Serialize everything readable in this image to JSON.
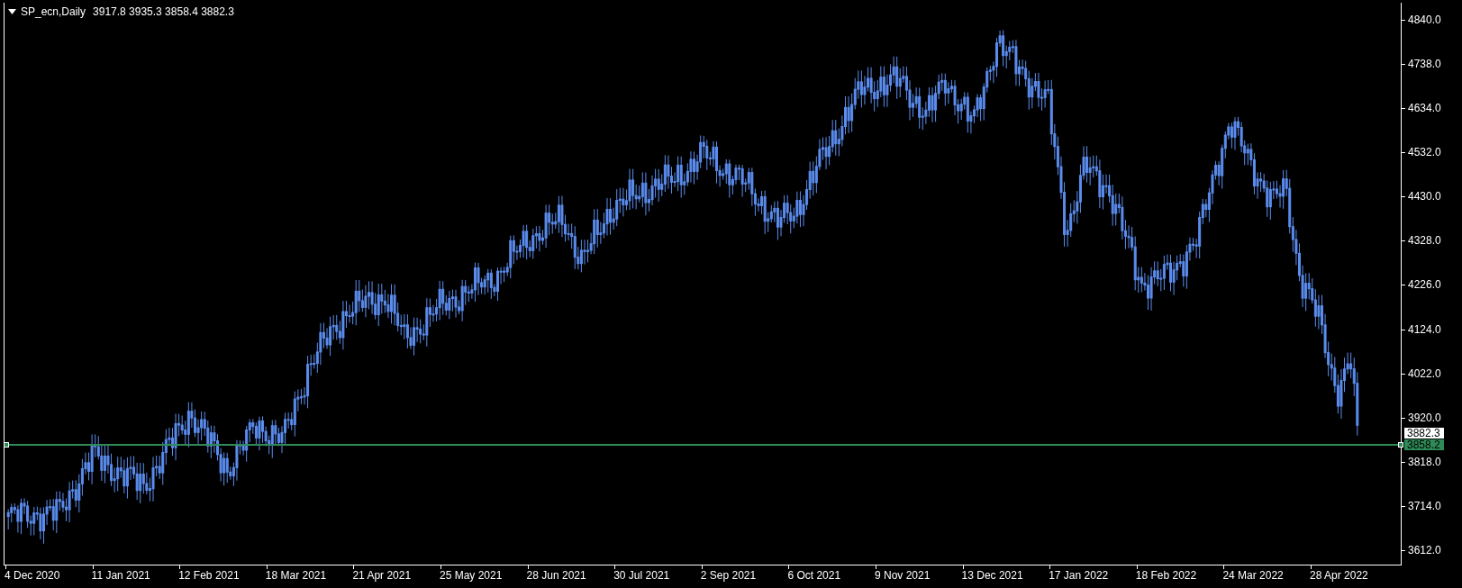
{
  "header": {
    "symbol": "SP_ecn,Daily",
    "ohlc": "3917.8 3935.3 3858.4 3882.3"
  },
  "price_axis": {
    "labels": [
      "4840.0",
      "4738.0",
      "4634.0",
      "4532.0",
      "4430.0",
      "4328.0",
      "4226.0",
      "4124.0",
      "4022.0",
      "3920.0",
      "3818.0",
      "3714.0",
      "3612.0"
    ]
  },
  "bid_marker": "3882.3",
  "horizontal_line": {
    "price": "3858.2",
    "color": "#2e8b57"
  },
  "time_axis": {
    "labels": [
      "4 Dec 2020",
      "11 Jan 2021",
      "12 Feb 2021",
      "18 Mar 2021",
      "21 Apr 2021",
      "25 May 2021",
      "28 Jun 2021",
      "30 Jul 2021",
      "2 Sep 2021",
      "6 Oct 2021",
      "9 Nov 2021",
      "13 Dec 2021",
      "17 Jan 2022",
      "18 Feb 2022",
      "24 Mar 2022",
      "28 Apr 2022"
    ]
  }
}
